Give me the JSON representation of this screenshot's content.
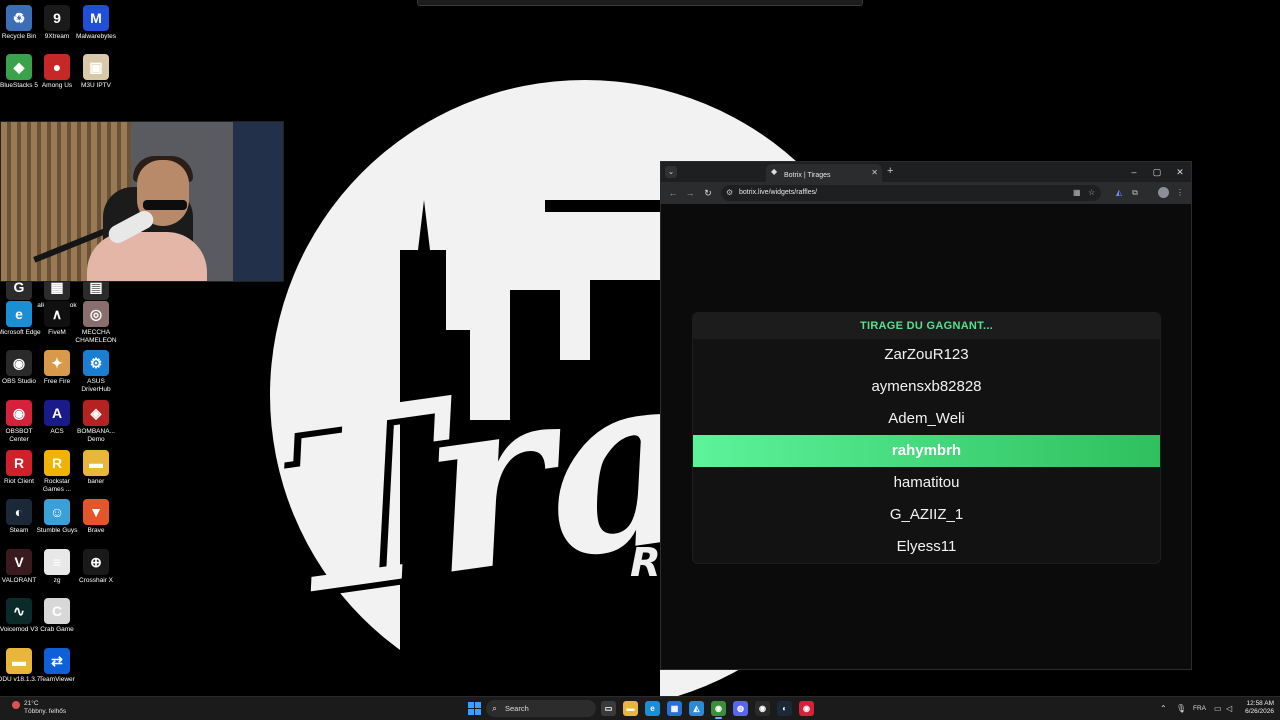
{
  "desktop": {
    "wallpaper": {
      "brand_text": "Trap",
      "sub_text": "R"
    },
    "icons": [
      {
        "label": "Recycle Bin",
        "icon": "recycle-bin-icon",
        "color": "#3b6fb5",
        "glyph": "♻"
      },
      {
        "label": "9Xtream",
        "icon": "9xtream-icon",
        "color": "#1a1a1a",
        "glyph": "9"
      },
      {
        "label": "Malwarebytes",
        "icon": "malwarebytes-icon",
        "color": "#1f4fd8",
        "glyph": "M"
      },
      {
        "label": "BlueStacks 5",
        "icon": "bluestacks-icon",
        "color": "#3aa24a",
        "glyph": "◆"
      },
      {
        "label": "Among Us",
        "icon": "among-us-icon",
        "color": "#c62828",
        "glyph": "●"
      },
      {
        "label": "M3U IPTV",
        "icon": "m3u-iptv-icon",
        "color": "#d8c9a8",
        "glyph": "▣"
      },
      {
        "label": "HUB",
        "icon": "logitech-hub-icon",
        "color": "#2b2b2b",
        "glyph": "G"
      },
      {
        "label": "alkalmazások",
        "icon": "apps-icon",
        "color": "#2b2b2b",
        "glyph": "▦"
      },
      {
        "label": "View",
        "icon": "view-icon",
        "color": "#2b2b2b",
        "glyph": "▤"
      },
      {
        "label": "Microsoft Edge",
        "icon": "edge-icon",
        "color": "#1a8fd6",
        "glyph": "e"
      },
      {
        "label": "FiveM",
        "icon": "fivem-icon",
        "color": "#101010",
        "glyph": "∧"
      },
      {
        "label": "MECCHA CHAMELEON",
        "icon": "meccha-chameleon-icon",
        "color": "#8a6d6d",
        "glyph": "◎"
      },
      {
        "label": "OBS Studio",
        "icon": "obs-studio-icon",
        "color": "#2a2a2a",
        "glyph": "◉"
      },
      {
        "label": "Free Fire",
        "icon": "free-fire-icon",
        "color": "#d89a4a",
        "glyph": "✦"
      },
      {
        "label": "ASUS DriverHub",
        "icon": "asus-driverhub-icon",
        "color": "#1b7fd1",
        "glyph": "⚙"
      },
      {
        "label": "OBSBOT Center",
        "icon": "obsbot-center-icon",
        "color": "#d6213b",
        "glyph": "◉"
      },
      {
        "label": "ACS",
        "icon": "acs-icon",
        "color": "#1a1a8a",
        "glyph": "A"
      },
      {
        "label": "BOMBANA... Demo",
        "icon": "bombana-demo-icon",
        "color": "#b52222",
        "glyph": "◈"
      },
      {
        "label": "Riot Client",
        "icon": "riot-client-icon",
        "color": "#d0202a",
        "glyph": "R"
      },
      {
        "label": "Rockstar Games ...",
        "icon": "rockstar-games-icon",
        "color": "#f0b400",
        "glyph": "R"
      },
      {
        "label": "baner",
        "icon": "folder-icon",
        "color": "#e8b73a",
        "glyph": "▬"
      },
      {
        "label": "Steam",
        "icon": "steam-icon",
        "color": "#1b2838",
        "glyph": "◐"
      },
      {
        "label": "Stumble Guys",
        "icon": "stumble-guys-icon",
        "color": "#3aa0d8",
        "glyph": "☺"
      },
      {
        "label": "Brave",
        "icon": "brave-icon",
        "color": "#e4552b",
        "glyph": "▼"
      },
      {
        "label": "VALORANT",
        "icon": "valorant-icon",
        "color": "#3a1a1f",
        "glyph": "V"
      },
      {
        "label": "zg",
        "icon": "text-file-icon",
        "color": "#e8e8e8",
        "glyph": "≡"
      },
      {
        "label": "Crosshair X",
        "icon": "crosshair-x-icon",
        "color": "#1a1a1a",
        "glyph": "⊕"
      },
      {
        "label": "Voicemod V3",
        "icon": "voicemod-icon",
        "color": "#0b2a2a",
        "glyph": "∿"
      },
      {
        "label": "Crab Game",
        "icon": "crab-game-icon",
        "color": "#d8d8d8",
        "glyph": "C"
      },
      {
        "label": "DDU v18.1.3.7",
        "icon": "folder-icon",
        "color": "#e8b73a",
        "glyph": "▬"
      },
      {
        "label": "TeamViewer",
        "icon": "teamviewer-icon",
        "color": "#0e5fd8",
        "glyph": "⇄"
      }
    ]
  },
  "browser": {
    "tab_title": "Botrix | Tirages",
    "url": "botrix.live/widgets/raffles/",
    "window_controls": {
      "minimize": "–",
      "maximize": "▢",
      "close": "✕"
    }
  },
  "raffle": {
    "heading": "TIRAGE DU GAGNANT...",
    "winner_color": "#4ee88a",
    "entries": [
      {
        "name": "ZarZouR123",
        "winner": false
      },
      {
        "name": "aymensxb82828",
        "winner": false
      },
      {
        "name": "Adem_Weli",
        "winner": false
      },
      {
        "name": "rahymbrh",
        "winner": true
      },
      {
        "name": "hamatitou",
        "winner": false
      },
      {
        "name": "G_AZIIZ_1",
        "winner": false
      },
      {
        "name": "Elyess11",
        "winner": false
      }
    ]
  },
  "taskbar": {
    "weather_temp": "21°C",
    "weather_desc": "Többny. felhős",
    "search_label": "Search",
    "language": "FRA",
    "time": "12:58 AM",
    "date": "6/26/2026",
    "apps": [
      {
        "name": "task-view",
        "color": "#3a3a3a",
        "glyph": "▭"
      },
      {
        "name": "file-explorer",
        "color": "#e8b73a",
        "glyph": "▬"
      },
      {
        "name": "edge",
        "color": "#1a8fd6",
        "glyph": "e"
      },
      {
        "name": "store",
        "color": "#2a6fd8",
        "glyph": "▦"
      },
      {
        "name": "photos",
        "color": "#2a8ad8",
        "glyph": "◭"
      },
      {
        "name": "chrome",
        "color": "#3c8d3c",
        "glyph": "◉",
        "active": true
      },
      {
        "name": "discord",
        "color": "#5865f2",
        "glyph": "◍"
      },
      {
        "name": "obs",
        "color": "#2a2a2a",
        "glyph": "◉"
      },
      {
        "name": "steam",
        "color": "#1b2838",
        "glyph": "◐"
      },
      {
        "name": "obsbot",
        "color": "#d6213b",
        "glyph": "◉"
      }
    ]
  }
}
